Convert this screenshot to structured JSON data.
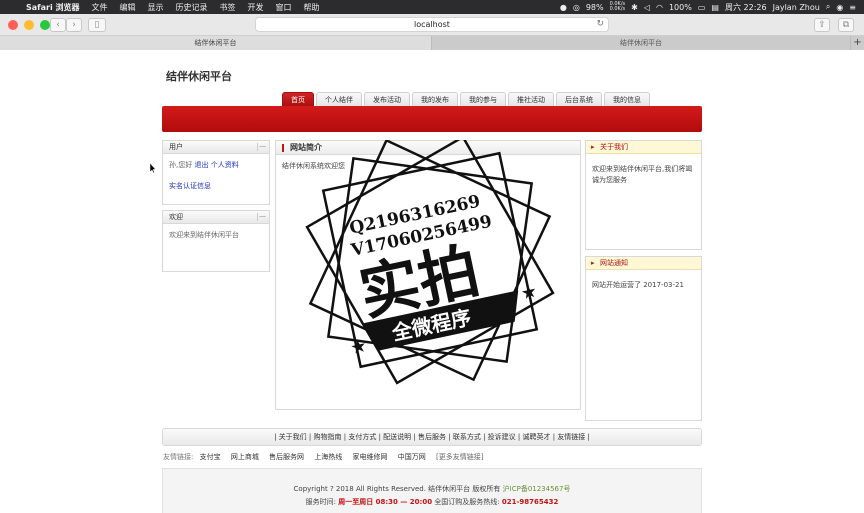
{
  "menubar": {
    "app": "Safari 浏览器",
    "items": [
      "文件",
      "编辑",
      "显示",
      "历史记录",
      "书签",
      "开发",
      "窗口",
      "帮助"
    ],
    "net_up": "0.0K/s",
    "net_down": "0.0K/s",
    "cpu": "98%",
    "battery": "100%",
    "datetime": "周六 22:26",
    "user": "Jaylan Zhou"
  },
  "browser": {
    "url": "localhost",
    "tabs": [
      "结伴休闲平台",
      "结伴休闲平台"
    ],
    "new_tab": "+"
  },
  "site": {
    "title": "结伴休闲平台",
    "nav": [
      "首页",
      "个人结伴",
      "发布活动",
      "我的发布",
      "我的参与",
      "推社活动",
      "后台系统",
      "我的信息"
    ]
  },
  "user_panel": {
    "title": "用户",
    "greeting": "孙,您好",
    "logout": "退出",
    "profile": "个人资料",
    "verify": "实名认证信息"
  },
  "welcome_panel": {
    "title": "欢迎",
    "text": "欢迎来到结伴休闲平台"
  },
  "intro_panel": {
    "title": "网站简介",
    "text": "结伴休闲系统欢迎您"
  },
  "about_panel": {
    "title": "关于我们",
    "text": "欢迎来到结伴休闲平台,我们将竭诚为您服务"
  },
  "notice_panel": {
    "title": "网站通知",
    "text": "网站开始运营了 2017-03-21"
  },
  "footer": {
    "links": [
      "关于我们",
      "购物指南",
      "支付方式",
      "配送说明",
      "售后服务",
      "联系方式",
      "投诉建议",
      "诚聘英才",
      "友情链接"
    ],
    "friends_label": "友情链接:",
    "friends": [
      "支付宝",
      "网上商城",
      "售后服务网",
      "上海热线",
      "家电维修网",
      "中国万网",
      "[更多友情链接]"
    ],
    "copyright_a": "Copyright ? 2018 All Rights Reserved. 结伴休闲平台 版权所有",
    "icp": "沪ICP备01234567号",
    "service_label": "服务时间:",
    "service_time": "周一至周日 08:30 — 20:00",
    "hotline_label": "全国订购及服务热线:",
    "hotline": "021-98765432"
  },
  "watermark": {
    "line1": "Q2196316269",
    "line2": "V17060256499",
    "big": "实拍",
    "banner": "全微程序"
  },
  "colors": {
    "brand_red": "#c41111",
    "link_blue": "#1c2fb8",
    "notice_bg": "#fff8d6"
  }
}
